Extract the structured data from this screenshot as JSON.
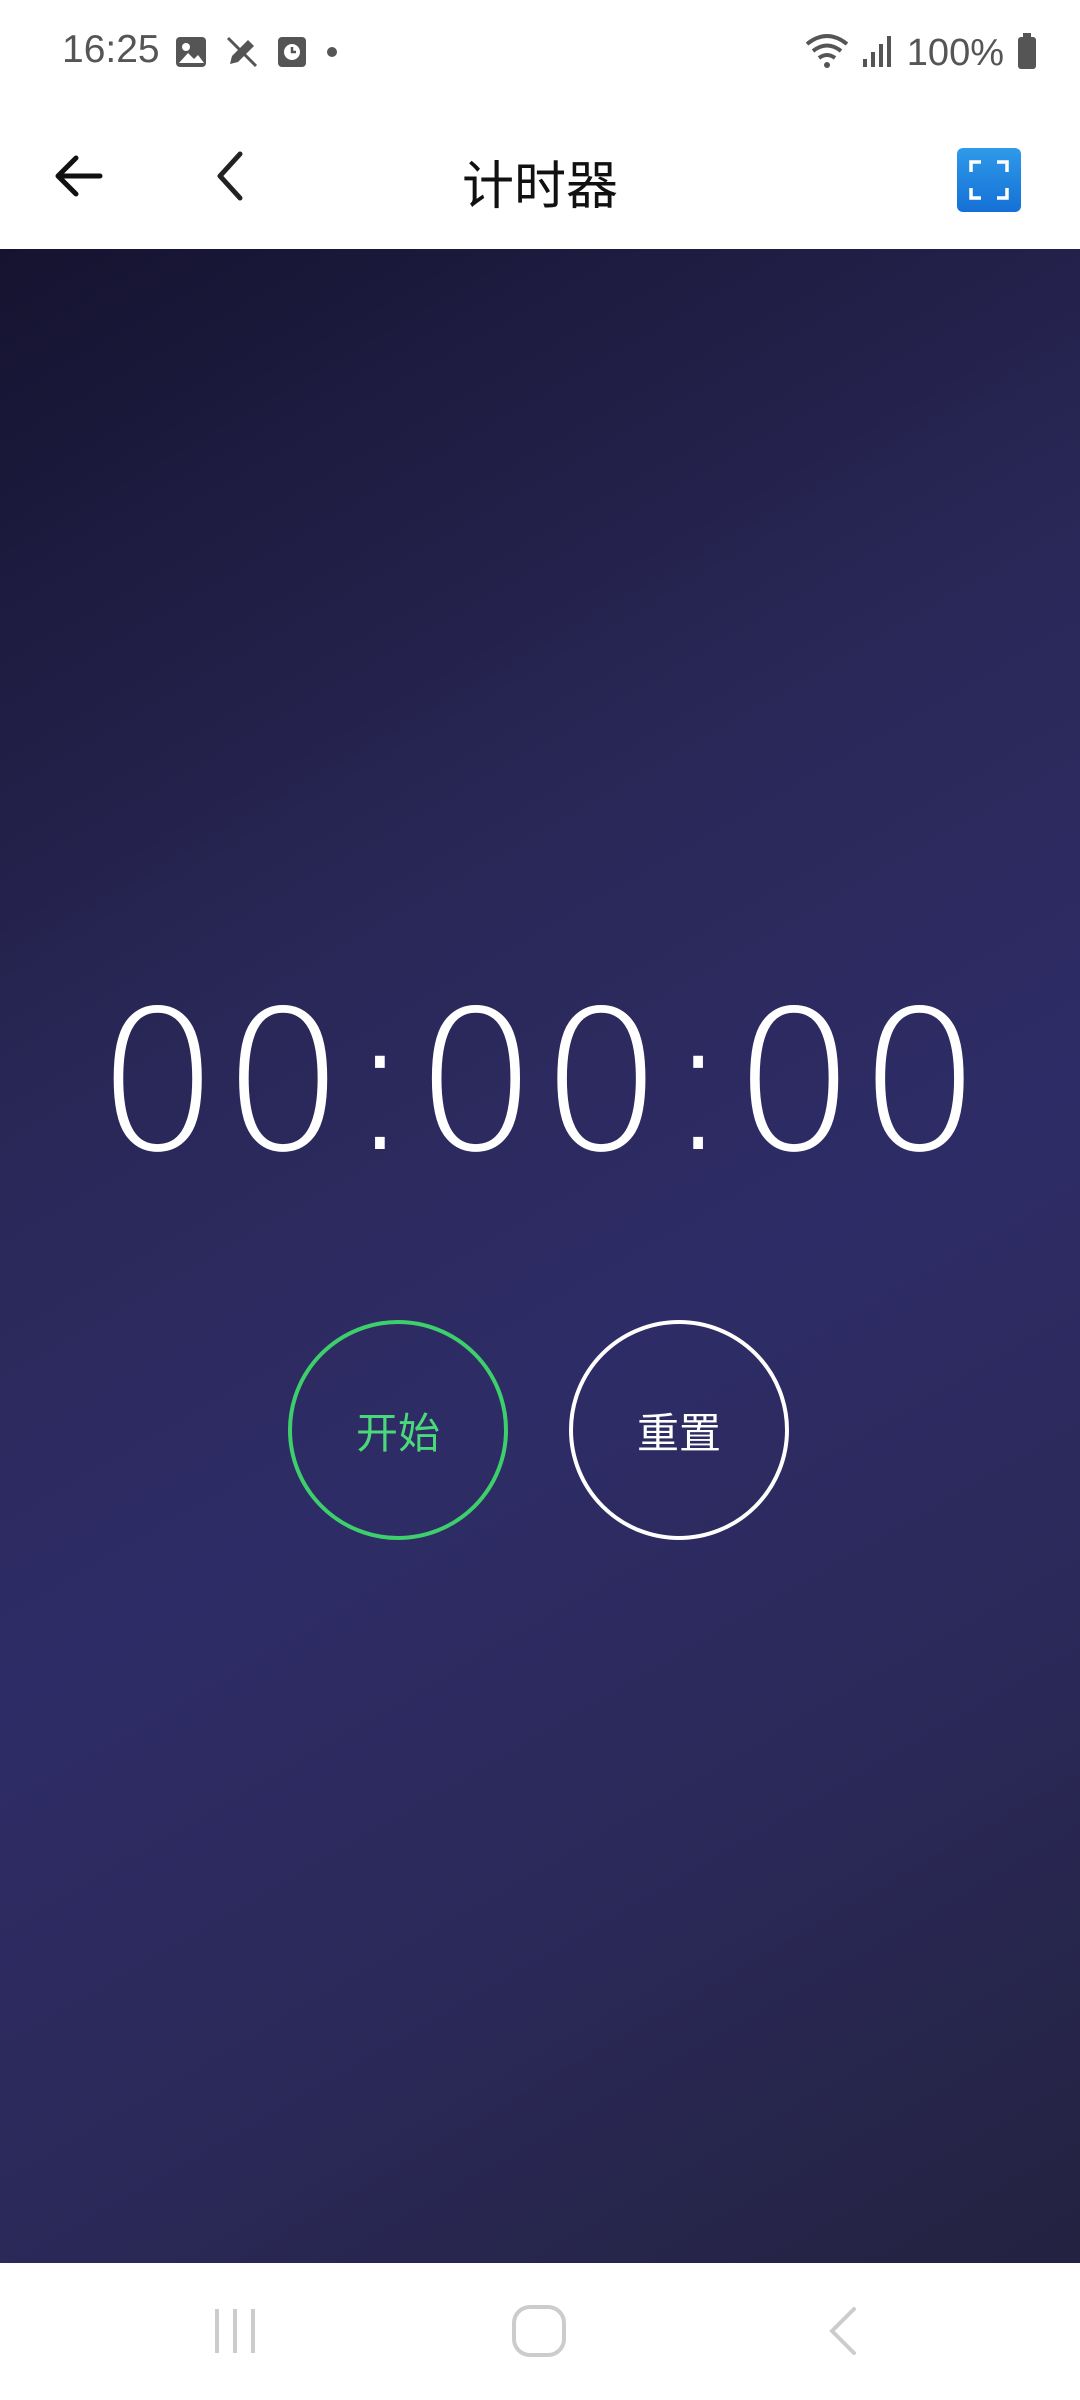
{
  "status_bar": {
    "time": "16:25",
    "battery": "100%",
    "left_icons": [
      "image-icon",
      "edit-off-icon",
      "clock-app-icon",
      "dot-icon"
    ],
    "right_icons": [
      "wifi-icon",
      "signal-icon",
      "battery-icon"
    ]
  },
  "app_bar": {
    "title": "计时器",
    "back_icon": "arrow-left-icon",
    "nav_icon": "chevron-left-icon",
    "action_icon": "fullscreen-icon",
    "action_color": "#1e7fe0"
  },
  "timer": {
    "display": "00:00:00",
    "start_label": "开始",
    "reset_label": "重置",
    "start_color": "#3dcf6b",
    "background_color": "#2e2c66"
  },
  "nav_bar": {
    "icons": [
      "recent-apps-icon",
      "home-icon",
      "back-icon"
    ]
  }
}
